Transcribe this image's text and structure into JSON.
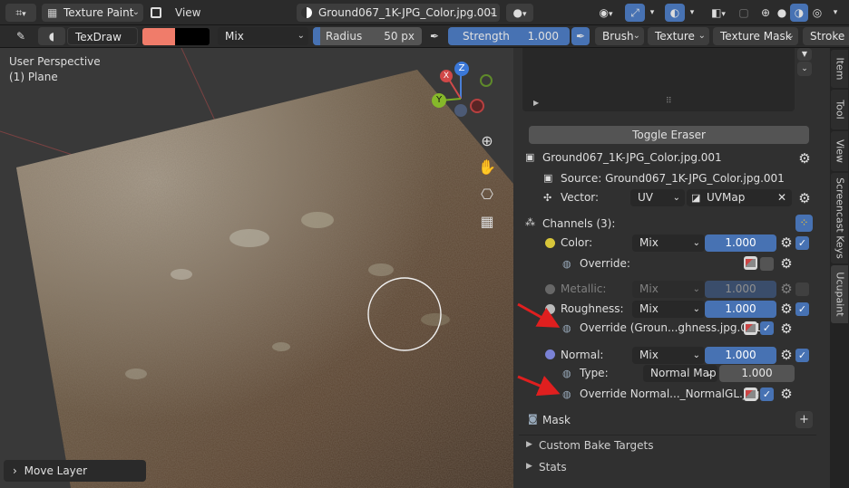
{
  "header": {
    "mode": "Texture Paint",
    "view_menu": "View",
    "image_name": "Ground067_1K-JPG_Color.jpg.001"
  },
  "toolbar": {
    "brush_name": "TexDraw",
    "blend": "Mix",
    "radius_label": "Radius",
    "radius_value": "50 px",
    "strength_label": "Strength",
    "strength_value": "1.000",
    "brush_menu": "Brush",
    "texture_menu": "Texture",
    "texture_mask_menu": "Texture Mask",
    "stroke_menu": "Stroke",
    "color_primary": "#f07c6a",
    "color_secondary": "#000000"
  },
  "viewport": {
    "perspective": "User Perspective",
    "object": "(1) Plane",
    "last_op": "Move Layer",
    "gizmo": {
      "x": "X",
      "y": "Y",
      "z": "Z"
    }
  },
  "panel": {
    "toggle_eraser": "Toggle Eraser",
    "layer_name": "Ground067_1K-JPG_Color.jpg.001",
    "source_label": "Source:",
    "source_value": "Ground067_1K-JPG_Color.jpg.001",
    "vector_label": "Vector:",
    "vector_type": "UV",
    "uvmap": "UVMap",
    "channels_label": "Channels (3):",
    "color_label": "Color:",
    "color_blend": "Mix",
    "color_value": "1.000",
    "override_label": "Override:",
    "metallic_label": "Metallic:",
    "metallic_blend": "Mix",
    "metallic_value": "1.000",
    "roughness_label": "Roughness:",
    "roughness_blend": "Mix",
    "roughness_value": "1.000",
    "roughness_override": "Override (Groun...ghness.jpg.001):",
    "normal_label": "Normal:",
    "normal_blend": "Mix",
    "normal_value": "1.000",
    "type_label": "Type:",
    "type_value": "Normal Map",
    "type_strength": "1.000",
    "normal_override": "Override Normal..._NormalGL.jpg):",
    "mask_label": "Mask",
    "custom_bake": "Custom Bake Targets",
    "stats": "Stats"
  },
  "tabs": [
    "Item",
    "Tool",
    "View",
    "Screencast Keys",
    "Ucupaint"
  ]
}
